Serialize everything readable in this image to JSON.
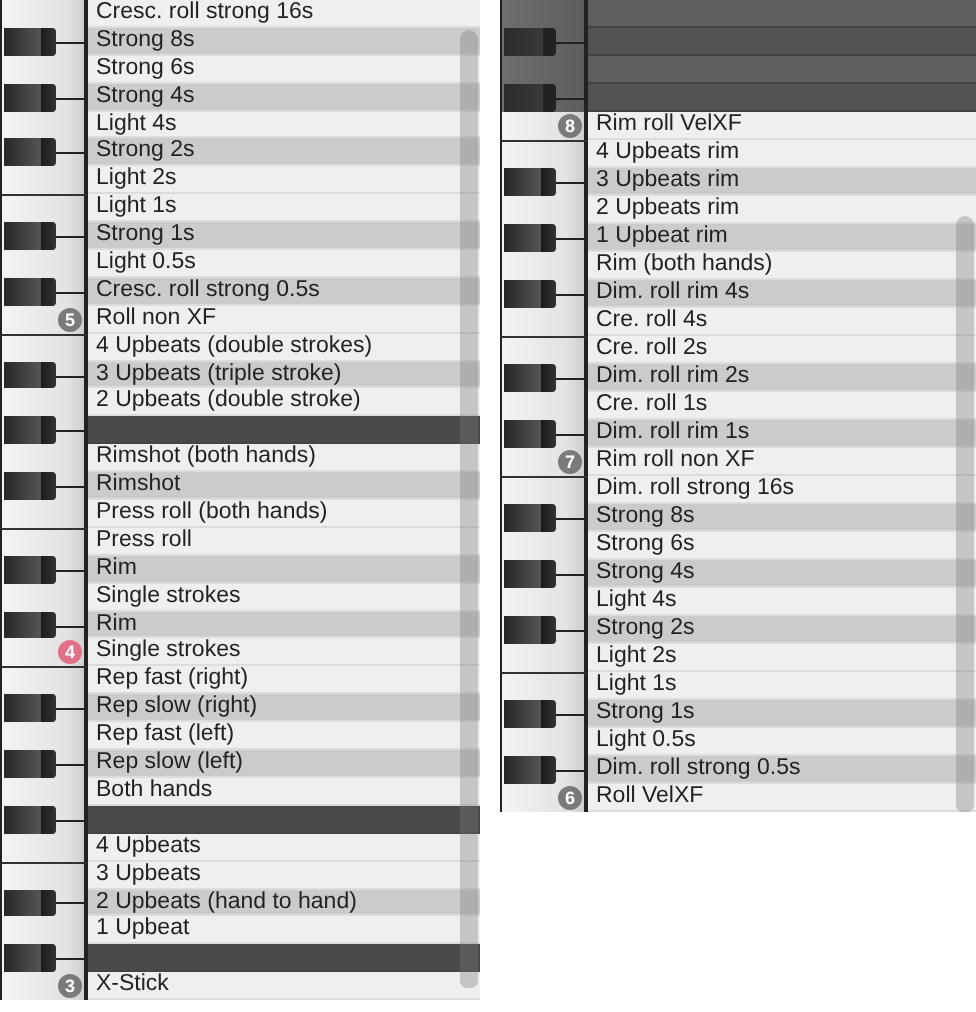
{
  "panels": [
    {
      "rows": [
        {
          "kind": "white",
          "disabled": false,
          "label": "Cresc. roll strong 16s"
        },
        {
          "kind": "black",
          "disabled": false,
          "label": "Strong 8s"
        },
        {
          "kind": "white",
          "disabled": false,
          "label": "Strong 6s"
        },
        {
          "kind": "black",
          "disabled": false,
          "label": "Strong 4s"
        },
        {
          "kind": "white",
          "disabled": false,
          "label": "Light 4s"
        },
        {
          "kind": "black",
          "disabled": false,
          "label": "Strong 2s"
        },
        {
          "kind": "white",
          "disabled": false,
          "label": "Light 2s"
        },
        {
          "kind": "white",
          "disabled": false,
          "label": "Light 1s"
        },
        {
          "kind": "black",
          "disabled": false,
          "label": "Strong 1s"
        },
        {
          "kind": "white",
          "disabled": false,
          "label": "Light 0.5s"
        },
        {
          "kind": "black",
          "disabled": false,
          "label": "Cresc. roll strong 0.5s"
        },
        {
          "kind": "white",
          "disabled": false,
          "label": "Roll non XF",
          "badge": {
            "text": "5",
            "color": "#7a7a7a"
          }
        },
        {
          "kind": "white",
          "disabled": false,
          "label": "4 Upbeats (double strokes)"
        },
        {
          "kind": "black",
          "disabled": false,
          "label": "3 Upbeats (triple stroke)"
        },
        {
          "kind": "white",
          "disabled": false,
          "label": "2 Upbeats (double stroke)"
        },
        {
          "kind": "black",
          "disabled": false
        },
        {
          "kind": "white",
          "disabled": false,
          "label": "Rimshot (both hands)"
        },
        {
          "kind": "black",
          "disabled": false,
          "label": "Rimshot"
        },
        {
          "kind": "white",
          "disabled": false,
          "label": "Press roll (both hands)"
        },
        {
          "kind": "white",
          "disabled": false,
          "label": "Press roll"
        },
        {
          "kind": "black",
          "disabled": false,
          "label": "Rim"
        },
        {
          "kind": "white",
          "disabled": false,
          "label": "Single strokes"
        },
        {
          "kind": "black",
          "disabled": false,
          "label": "Rim"
        },
        {
          "kind": "white",
          "disabled": false,
          "label": "Single strokes",
          "badge": {
            "text": "4",
            "color": "#e0708a"
          }
        },
        {
          "kind": "white",
          "disabled": false,
          "label": "Rep fast (right)"
        },
        {
          "kind": "black",
          "disabled": false,
          "label": "Rep slow (right)"
        },
        {
          "kind": "white",
          "disabled": false,
          "label": "Rep fast (left)"
        },
        {
          "kind": "black",
          "disabled": false,
          "label": "Rep slow (left)"
        },
        {
          "kind": "white",
          "disabled": false,
          "label": "Both hands"
        },
        {
          "kind": "black",
          "disabled": false
        },
        {
          "kind": "white",
          "disabled": false,
          "label": "4 Upbeats"
        },
        {
          "kind": "white",
          "disabled": false,
          "label": "3 Upbeats"
        },
        {
          "kind": "black",
          "disabled": false,
          "label": "2 Upbeats (hand to hand)"
        },
        {
          "kind": "white",
          "disabled": false,
          "label": "1 Upbeat"
        },
        {
          "kind": "black",
          "disabled": false
        },
        {
          "kind": "white",
          "disabled": false,
          "label": "X-Stick",
          "badge": {
            "text": "3",
            "color": "#7a7a7a"
          }
        }
      ]
    },
    {
      "rows": [
        {
          "kind": "white",
          "disabled": true
        },
        {
          "kind": "black",
          "disabled": true
        },
        {
          "kind": "white",
          "disabled": true
        },
        {
          "kind": "black",
          "disabled": true
        },
        {
          "kind": "white",
          "disabled": false,
          "label": "Rim roll VelXF",
          "badge": {
            "text": "8",
            "color": "#7a7a7a"
          }
        },
        {
          "kind": "white",
          "disabled": false,
          "label": "4 Upbeats rim"
        },
        {
          "kind": "black",
          "disabled": false,
          "label": "3 Upbeats rim"
        },
        {
          "kind": "white",
          "disabled": false,
          "label": "2 Upbeats rim"
        },
        {
          "kind": "black",
          "disabled": false,
          "label": "1 Upbeat rim"
        },
        {
          "kind": "white",
          "disabled": false,
          "label": "Rim (both hands)"
        },
        {
          "kind": "black",
          "disabled": false,
          "label": "Dim. roll rim 4s"
        },
        {
          "kind": "white",
          "disabled": false,
          "label": "Cre. roll 4s"
        },
        {
          "kind": "white",
          "disabled": false,
          "label": "Cre. roll 2s"
        },
        {
          "kind": "black",
          "disabled": false,
          "label": "Dim. roll rim 2s"
        },
        {
          "kind": "white",
          "disabled": false,
          "label": "Cre. roll 1s"
        },
        {
          "kind": "black",
          "disabled": false,
          "label": "Dim. roll rim 1s"
        },
        {
          "kind": "white",
          "disabled": false,
          "label": "Rim roll non XF",
          "badge": {
            "text": "7",
            "color": "#7a7a7a"
          }
        },
        {
          "kind": "white",
          "disabled": false,
          "label": "Dim. roll strong 16s"
        },
        {
          "kind": "black",
          "disabled": false,
          "label": "Strong 8s"
        },
        {
          "kind": "white",
          "disabled": false,
          "label": "Strong 6s"
        },
        {
          "kind": "black",
          "disabled": false,
          "label": "Strong 4s"
        },
        {
          "kind": "white",
          "disabled": false,
          "label": "Light 4s"
        },
        {
          "kind": "black",
          "disabled": false,
          "label": "Strong 2s"
        },
        {
          "kind": "white",
          "disabled": false,
          "label": "Light 2s"
        },
        {
          "kind": "white",
          "disabled": false,
          "label": "Light 1s"
        },
        {
          "kind": "black",
          "disabled": false,
          "label": "Strong 1s"
        },
        {
          "kind": "white",
          "disabled": false,
          "label": "Light 0.5s"
        },
        {
          "kind": "black",
          "disabled": false,
          "label": "Dim. roll strong 0.5s"
        },
        {
          "kind": "white",
          "disabled": false,
          "label": "Roll VelXF",
          "badge": {
            "text": "6",
            "color": "#7a7a7a"
          }
        }
      ]
    }
  ]
}
